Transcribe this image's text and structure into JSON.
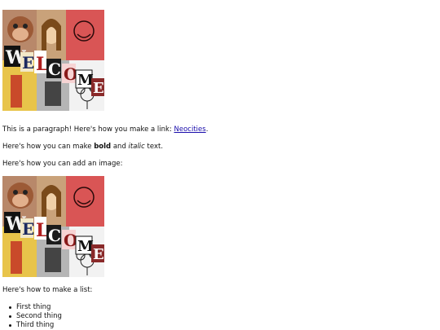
{
  "images": {
    "welcome_letters": [
      "W",
      "E",
      "L",
      "C",
      "O",
      "M",
      "E"
    ]
  },
  "paragraph1": {
    "text": "This is a paragraph! Here's how you make a link: ",
    "link_label": "Neocities",
    "after": "."
  },
  "paragraph2": {
    "before": "Here's how you can make ",
    "bold": "bold",
    "middle": " and ",
    "italic": "italic",
    "after": " text."
  },
  "paragraph3": {
    "text": "Here's how you can add an image:"
  },
  "paragraph4": {
    "text": "Here's how to make a list:"
  },
  "list": {
    "items": [
      "First thing",
      "Second thing",
      "Third thing"
    ]
  }
}
